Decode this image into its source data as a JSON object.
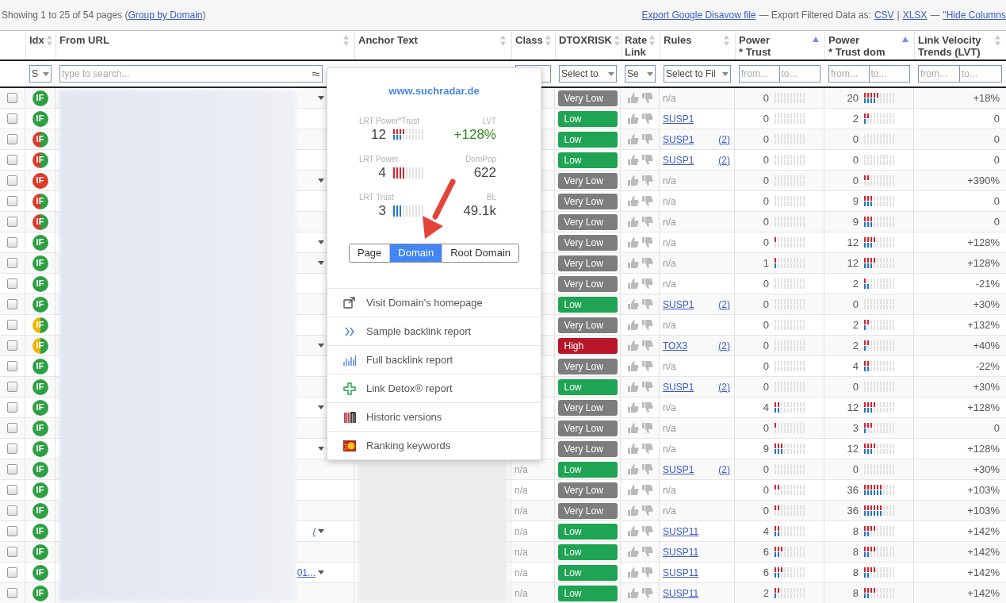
{
  "summary": {
    "prefix": "Showing 1 to 25 of 54 pages (",
    "link": "Group by Domain",
    "suffix": ")"
  },
  "exports": [
    {
      "kind": "link",
      "text": "Export Google Disavow file"
    },
    {
      "kind": "text",
      "text": "— Export Filtered Data as:"
    },
    {
      "kind": "link",
      "text": "CSV"
    },
    {
      "kind": "text",
      "text": "|"
    },
    {
      "kind": "link",
      "text": "XLSX"
    },
    {
      "kind": "text",
      "text": "—"
    },
    {
      "kind": "link",
      "text": "\"Hide Columns"
    }
  ],
  "columns": [
    {
      "label": "Idx",
      "sorted": false
    },
    {
      "label": "From URL",
      "sorted": false
    },
    {
      "label": "Anchor Text",
      "sorted": false
    },
    {
      "label": "Class",
      "sorted": false
    },
    {
      "label": "DTOXRISK",
      "sorted": false
    },
    {
      "label": "Rate\nLink",
      "sorted": false
    },
    {
      "label": "Rules",
      "sorted": false
    },
    {
      "label": "Power\n* Trust",
      "sorted": true
    },
    {
      "label": "Power\n* Trust dom",
      "sorted": true
    },
    {
      "label": "Link Velocity\nTrends (LVT)",
      "sorted": false
    }
  ],
  "filters": [
    {
      "kind": "select",
      "text": "S"
    },
    {
      "kind": "search",
      "placeholder": "type to search..."
    },
    {
      "kind": "empty"
    },
    {
      "kind": "select"
    },
    {
      "kind": "select",
      "text": "Select to"
    },
    {
      "kind": "select",
      "text": "Se"
    },
    {
      "kind": "select",
      "text": "Select to Fil"
    },
    {
      "kind": "range",
      "from": {
        "placeholder": "from..."
      },
      "to": {
        "placeholder": "to..."
      }
    },
    {
      "kind": "range",
      "from": {
        "placeholder": "from..."
      },
      "to": {
        "placeholder": "to..."
      }
    },
    {
      "kind": "range",
      "from": {
        "placeholder": "from..."
      },
      "to": {
        "placeholder": "to..."
      }
    }
  ],
  "rows": [
    {
      "checked": false,
      "badge": {
        "text": "IF",
        "kind": "green"
      },
      "has_menu": true,
      "risk": {
        "label": "Very Low",
        "kind": "very-low"
      },
      "rule": {
        "kind": "plain",
        "text": "n/a"
      },
      "pt": "0",
      "pt_power": {
        "level": 0
      },
      "pt_trust": {
        "level": 0
      },
      "ptd": "20",
      "ptd_power": {
        "level": 0.5
      },
      "ptd_trust": {
        "level": 0.4
      },
      "lvt": "+18%"
    },
    {
      "checked": false,
      "badge": {
        "text": "IF",
        "kind": "green"
      },
      "has_menu": false,
      "risk": {
        "label": "Low",
        "kind": "low"
      },
      "rule": {
        "kind": "link",
        "text": "SUSP1"
      },
      "pt": "0",
      "pt_power": {
        "level": 0
      },
      "pt_trust": {
        "level": 0
      },
      "ptd": "2",
      "ptd_power": {
        "level": 0.2
      },
      "ptd_trust": {
        "level": 0.1
      },
      "lvt": "0"
    },
    {
      "checked": false,
      "badge": {
        "text": "IF",
        "kind": "red-green"
      },
      "has_menu": false,
      "risk": {
        "label": "Low",
        "kind": "low"
      },
      "rule": {
        "kind": "link",
        "text": "SUSP1",
        "count": "(2)"
      },
      "pt": "0",
      "pt_power": {
        "level": 0
      },
      "pt_trust": {
        "level": 0
      },
      "ptd": "0",
      "ptd_power": {
        "level": 0
      },
      "ptd_trust": {
        "level": 0
      },
      "lvt": "0"
    },
    {
      "checked": false,
      "badge": {
        "text": "IF",
        "kind": "red-green"
      },
      "has_menu": false,
      "risk": {
        "label": "Low",
        "kind": "low"
      },
      "rule": {
        "kind": "link",
        "text": "SUSP1",
        "count": "(2)"
      },
      "pt": "0",
      "pt_power": {
        "level": 0
      },
      "pt_trust": {
        "level": 0
      },
      "ptd": "0",
      "ptd_power": {
        "level": 0
      },
      "ptd_trust": {
        "level": 0
      },
      "lvt": "0"
    },
    {
      "checked": false,
      "badge": {
        "text": "IF",
        "kind": "red"
      },
      "has_menu": true,
      "risk": {
        "label": "Very Low",
        "kind": "very-low"
      },
      "rule": {
        "kind": "plain",
        "text": "n/a"
      },
      "pt": "0",
      "pt_power": {
        "level": 0
      },
      "pt_trust": {
        "level": 0
      },
      "ptd": "0",
      "ptd_power": {
        "level": 0.2
      },
      "ptd_trust": {
        "level": 0
      },
      "lvt": "+390%"
    },
    {
      "checked": false,
      "badge": {
        "text": "IF",
        "kind": "red-green"
      },
      "has_menu": false,
      "risk": {
        "label": "Very Low",
        "kind": "very-low"
      },
      "rule": {
        "kind": "plain",
        "text": "n/a"
      },
      "pt": "0",
      "pt_power": {
        "level": 0
      },
      "pt_trust": {
        "level": 0
      },
      "ptd": "9",
      "ptd_power": {
        "level": 0.3
      },
      "ptd_trust": {
        "level": 0.3
      },
      "lvt": "0"
    },
    {
      "checked": false,
      "badge": {
        "text": "IF",
        "kind": "red-green"
      },
      "has_menu": false,
      "risk": {
        "label": "Very Low",
        "kind": "very-low"
      },
      "rule": {
        "kind": "plain",
        "text": "n/a"
      },
      "pt": "0",
      "pt_power": {
        "level": 0
      },
      "pt_trust": {
        "level": 0
      },
      "ptd": "9",
      "ptd_power": {
        "level": 0.3
      },
      "ptd_trust": {
        "level": 0.3
      },
      "lvt": "0"
    },
    {
      "checked": false,
      "badge": {
        "text": "IF",
        "kind": "green"
      },
      "has_menu": true,
      "risk": {
        "label": "Very Low",
        "kind": "very-low"
      },
      "rule": {
        "kind": "plain",
        "text": "n/a"
      },
      "pt": "0",
      "pt_power": {
        "level": 0.1
      },
      "pt_trust": {
        "level": 0
      },
      "ptd": "12",
      "ptd_power": {
        "level": 0.4
      },
      "ptd_trust": {
        "level": 0.3
      },
      "lvt": "+128%"
    },
    {
      "checked": false,
      "badge": {
        "text": "IF",
        "kind": "green"
      },
      "has_menu": true,
      "risk": {
        "label": "Very Low",
        "kind": "very-low"
      },
      "rule": {
        "kind": "plain",
        "text": "n/a"
      },
      "pt": "1",
      "pt_power": {
        "level": 0.1
      },
      "pt_trust": {
        "level": 0.1
      },
      "ptd": "12",
      "ptd_power": {
        "level": 0.4
      },
      "ptd_trust": {
        "level": 0.3
      },
      "lvt": "+128%"
    },
    {
      "checked": false,
      "badge": {
        "text": "IF",
        "kind": "green"
      },
      "has_menu": false,
      "risk": {
        "label": "Very Low",
        "kind": "very-low"
      },
      "rule": {
        "kind": "plain",
        "text": "n/a"
      },
      "pt": "0",
      "pt_power": {
        "level": 0
      },
      "pt_trust": {
        "level": 0
      },
      "ptd": "2",
      "ptd_power": {
        "level": 0.1
      },
      "ptd_trust": {
        "level": 0.2
      },
      "lvt": "-21%"
    },
    {
      "checked": false,
      "badge": {
        "text": "IF",
        "kind": "green"
      },
      "has_menu": false,
      "risk": {
        "label": "Low",
        "kind": "low"
      },
      "rule": {
        "kind": "link",
        "text": "SUSP1",
        "count": "(2)"
      },
      "pt": "0",
      "pt_power": {
        "level": 0
      },
      "pt_trust": {
        "level": 0
      },
      "ptd": "0",
      "ptd_power": {
        "level": 0
      },
      "ptd_trust": {
        "level": 0
      },
      "lvt": "+30%"
    },
    {
      "checked": false,
      "badge": {
        "text": "IF",
        "kind": "yellow-green"
      },
      "has_menu": false,
      "risk": {
        "label": "Very Low",
        "kind": "very-low"
      },
      "rule": {
        "kind": "plain",
        "text": "n/a"
      },
      "pt": "0",
      "pt_power": {
        "level": 0
      },
      "pt_trust": {
        "level": 0
      },
      "ptd": "2",
      "ptd_power": {
        "level": 0.2
      },
      "ptd_trust": {
        "level": 0.1
      },
      "lvt": "+132%"
    },
    {
      "checked": false,
      "badge": {
        "text": "IF",
        "kind": "yellow-green"
      },
      "has_menu": true,
      "risk": {
        "label": "High",
        "kind": "high"
      },
      "rule": {
        "kind": "link",
        "text": "TOX3",
        "count": "(2)"
      },
      "pt": "0",
      "pt_power": {
        "level": 0
      },
      "pt_trust": {
        "level": 0
      },
      "ptd": "2",
      "ptd_power": {
        "level": 0.2
      },
      "ptd_trust": {
        "level": 0.1
      },
      "lvt": "+40%"
    },
    {
      "checked": false,
      "badge": {
        "text": "IF",
        "kind": "green"
      },
      "has_menu": false,
      "risk": {
        "label": "Very Low",
        "kind": "very-low"
      },
      "rule": {
        "kind": "plain",
        "text": "n/a"
      },
      "pt": "0",
      "pt_power": {
        "level": 0
      },
      "pt_trust": {
        "level": 0
      },
      "ptd": "4",
      "ptd_power": {
        "level": 0.2
      },
      "ptd_trust": {
        "level": 0.2
      },
      "lvt": "-22%"
    },
    {
      "checked": false,
      "badge": {
        "text": "IF",
        "kind": "green"
      },
      "has_menu": false,
      "risk": {
        "label": "Low",
        "kind": "low"
      },
      "rule": {
        "kind": "link",
        "text": "SUSP1",
        "count": "(2)"
      },
      "pt": "0",
      "pt_power": {
        "level": 0
      },
      "pt_trust": {
        "level": 0
      },
      "ptd": "0",
      "ptd_power": {
        "level": 0
      },
      "ptd_trust": {
        "level": 0
      },
      "lvt": "+30%"
    },
    {
      "checked": false,
      "badge": {
        "text": "IF",
        "kind": "green"
      },
      "has_menu": true,
      "risk": {
        "label": "Very Low",
        "kind": "very-low"
      },
      "rule": {
        "kind": "plain",
        "text": "n/a"
      },
      "pt": "4",
      "pt_power": {
        "level": 0.2
      },
      "pt_trust": {
        "level": 0.2
      },
      "ptd": "12",
      "ptd_power": {
        "level": 0.4
      },
      "ptd_trust": {
        "level": 0.3
      },
      "lvt": "+128%"
    },
    {
      "checked": false,
      "badge": {
        "text": "IF",
        "kind": "green"
      },
      "has_menu": false,
      "risk": {
        "label": "Very Low",
        "kind": "very-low"
      },
      "rule": {
        "kind": "plain",
        "text": "n/a"
      },
      "pt": "0",
      "pt_power": {
        "level": 0.1
      },
      "pt_trust": {
        "level": 0
      },
      "ptd": "3",
      "ptd_power": {
        "level": 0.3
      },
      "ptd_trust": {
        "level": 0.1
      },
      "lvt": "0"
    },
    {
      "checked": false,
      "badge": {
        "text": "IF",
        "kind": "green"
      },
      "has_menu": true,
      "risk": {
        "label": "Very Low",
        "kind": "very-low"
      },
      "rule": {
        "kind": "plain",
        "text": "n/a"
      },
      "pt": "9",
      "pt_power": {
        "level": 0.3
      },
      "pt_trust": {
        "level": 0.3
      },
      "ptd": "12",
      "ptd_power": {
        "level": 0.4
      },
      "ptd_trust": {
        "level": 0.3
      },
      "lvt": "+128%"
    },
    {
      "checked": false,
      "badge": {
        "text": "IF",
        "kind": "green"
      },
      "has_menu": false,
      "class": "n/a",
      "risk": {
        "label": "Low",
        "kind": "low"
      },
      "rule": {
        "kind": "link",
        "text": "SUSP1",
        "count": "(2)"
      },
      "pt": "0",
      "pt_power": {
        "level": 0
      },
      "pt_trust": {
        "level": 0
      },
      "ptd": "0",
      "ptd_power": {
        "level": 0
      },
      "ptd_trust": {
        "level": 0
      },
      "lvt": "+30%"
    },
    {
      "checked": false,
      "badge": {
        "text": "IF",
        "kind": "green"
      },
      "has_menu": false,
      "class": "n/a",
      "risk": {
        "label": "Very Low",
        "kind": "very-low"
      },
      "rule": {
        "kind": "plain",
        "text": "n/a"
      },
      "pt": "0",
      "pt_power": {
        "level": 0.2
      },
      "pt_trust": {
        "level": 0
      },
      "ptd": "36",
      "ptd_power": {
        "level": 0.6
      },
      "ptd_trust": {
        "level": 0.6
      },
      "lvt": "+103%"
    },
    {
      "checked": false,
      "badge": {
        "text": "IF",
        "kind": "green"
      },
      "has_menu": false,
      "class": "n/a",
      "risk": {
        "label": "Very Low",
        "kind": "very-low"
      },
      "rule": {
        "kind": "plain",
        "text": "n/a"
      },
      "pt": "0",
      "pt_power": {
        "level": 0.2
      },
      "pt_trust": {
        "level": 0
      },
      "ptd": "36",
      "ptd_power": {
        "level": 0.6
      },
      "ptd_trust": {
        "level": 0.6
      },
      "lvt": "+103%"
    },
    {
      "checked": false,
      "badge": {
        "text": "IF",
        "kind": "green"
      },
      "url_tail": "/",
      "has_menu": true,
      "class": "n/a",
      "risk": {
        "label": "Low",
        "kind": "low"
      },
      "rule": {
        "kind": "link",
        "text": "SUSP11"
      },
      "pt": "4",
      "pt_power": {
        "level": 0.2
      },
      "pt_trust": {
        "level": 0.2
      },
      "ptd": "8",
      "ptd_power": {
        "level": 0.4
      },
      "ptd_trust": {
        "level": 0.2
      },
      "lvt": "+142%"
    },
    {
      "checked": false,
      "badge": {
        "text": "IF",
        "kind": "green"
      },
      "has_menu": false,
      "class": "n/a",
      "risk": {
        "label": "Low",
        "kind": "low"
      },
      "rule": {
        "kind": "link",
        "text": "SUSP11"
      },
      "pt": "6",
      "pt_power": {
        "level": 0.3
      },
      "pt_trust": {
        "level": 0.2
      },
      "ptd": "8",
      "ptd_power": {
        "level": 0.4
      },
      "ptd_trust": {
        "level": 0.2
      },
      "lvt": "+142%"
    },
    {
      "checked": false,
      "badge": {
        "text": "IF",
        "kind": "green"
      },
      "url_tail": "01...",
      "has_menu": true,
      "class": "n/a",
      "risk": {
        "label": "Low",
        "kind": "low"
      },
      "rule": {
        "kind": "link",
        "text": "SUSP11"
      },
      "pt": "6",
      "pt_power": {
        "level": 0.3
      },
      "pt_trust": {
        "level": 0.2
      },
      "ptd": "8",
      "ptd_power": {
        "level": 0.4
      },
      "ptd_trust": {
        "level": 0.2
      },
      "lvt": "+142%"
    },
    {
      "checked": false,
      "badge": {
        "text": "IF",
        "kind": "green"
      },
      "has_menu": false,
      "class": "n/a",
      "risk": {
        "label": "Low",
        "kind": "low"
      },
      "rule": {
        "kind": "link",
        "text": "SUSP11"
      },
      "pt": "2",
      "pt_power": {
        "level": 0.2
      },
      "pt_trust": {
        "level": 0.1
      },
      "ptd": "8",
      "ptd_power": {
        "level": 0.4
      },
      "ptd_trust": {
        "level": 0.2
      },
      "lvt": "+142%"
    }
  ],
  "popup": {
    "title": "www.suchradar.de",
    "stats": [
      {
        "kind": "meter",
        "label": "LRT Power*Trust",
        "value": "12",
        "power": {
          "level": 0.4
        },
        "trust": {
          "level": 0.3
        }
      },
      {
        "kind": "value",
        "label": "LVT",
        "value": "+128%",
        "positive": true
      },
      {
        "kind": "meter",
        "label": "LRT Power",
        "value": "4",
        "power": {
          "level": 0.4
        }
      },
      {
        "kind": "value",
        "label": "DomPop",
        "value": "622",
        "positive": false
      },
      {
        "kind": "meter",
        "label": "LRT Trust",
        "value": "3",
        "trust": {
          "level": 0.3
        }
      },
      {
        "kind": "value",
        "label": "BL",
        "value": "49.1k",
        "positive": false
      }
    ],
    "scopes": [
      {
        "label": "Page",
        "selected": false
      },
      {
        "label": "Domain",
        "selected": true
      },
      {
        "label": "Root Domain",
        "selected": false
      }
    ],
    "menu": [
      {
        "kind": "external",
        "label": "Visit Domain's homepage"
      },
      {
        "kind": "chevrons",
        "label": "Sample backlink report"
      },
      {
        "kind": "bars",
        "label": "Full backlink report"
      },
      {
        "kind": "plus",
        "label": "Link Detox® report"
      },
      {
        "kind": "stripes",
        "label": "Historic versions"
      },
      {
        "kind": "fireball",
        "label": "Ranking keywords"
      }
    ]
  }
}
